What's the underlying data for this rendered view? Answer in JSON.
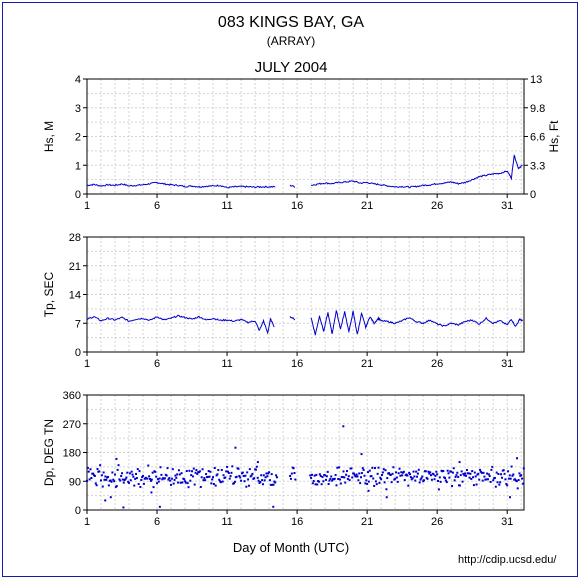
{
  "title": "083 KINGS BAY, GA",
  "subtitle": "(ARRAY)",
  "month": "JULY 2004",
  "xlabel": "Day of Month (UTC)",
  "url": "http://cdip.ucsd.edu/",
  "colors": {
    "series": "#0000cc",
    "frame": "#1a1aa8",
    "grid": "#c8c8c8"
  },
  "chart_data": [
    {
      "type": "line",
      "ylabel": "Hs, M",
      "ylabel_right": "Hs, Ft",
      "ylim": [
        0,
        4
      ],
      "yticks": [
        "0",
        "1",
        "2",
        "3",
        "4"
      ],
      "yticks_right": [
        "0",
        "3.3",
        "6.6",
        "9.8",
        "13"
      ],
      "xlim": [
        1,
        32.2
      ],
      "xticks": [
        "1",
        "6",
        "11",
        "16",
        "21",
        "26",
        "31"
      ],
      "grid": true,
      "gaps": [
        [
          14.6,
          15.5
        ],
        [
          15.9,
          16.9
        ]
      ],
      "x": [
        1,
        1.5,
        2,
        2.5,
        3,
        3.5,
        4,
        4.5,
        5,
        5.5,
        6,
        6.5,
        7,
        7.5,
        8,
        8.5,
        9,
        9.5,
        10,
        10.5,
        11,
        11.5,
        12,
        12.5,
        13,
        13.5,
        14,
        14.5,
        15.5,
        15.9,
        17,
        17.5,
        18,
        18.5,
        19,
        19.5,
        20,
        20.5,
        21,
        21.5,
        22,
        22.5,
        23,
        23.5,
        24,
        24.5,
        25,
        25.5,
        26,
        26.5,
        27,
        27.5,
        28,
        28.5,
        29,
        29.5,
        30,
        30.5,
        31,
        31.3,
        31.5,
        31.8,
        32.1
      ],
      "y": [
        0.3,
        0.33,
        0.28,
        0.32,
        0.3,
        0.35,
        0.28,
        0.3,
        0.32,
        0.36,
        0.4,
        0.35,
        0.32,
        0.3,
        0.26,
        0.28,
        0.25,
        0.27,
        0.28,
        0.3,
        0.22,
        0.25,
        0.26,
        0.25,
        0.24,
        0.25,
        0.25,
        0.25,
        0.3,
        0.25,
        0.3,
        0.35,
        0.38,
        0.36,
        0.4,
        0.42,
        0.45,
        0.38,
        0.4,
        0.35,
        0.32,
        0.28,
        0.25,
        0.26,
        0.24,
        0.26,
        0.3,
        0.32,
        0.36,
        0.38,
        0.42,
        0.36,
        0.4,
        0.5,
        0.6,
        0.65,
        0.7,
        0.72,
        0.8,
        0.55,
        1.35,
        0.9,
        1.0
      ]
    },
    {
      "type": "line",
      "ylabel": "Tp, SEC",
      "ylim": [
        0,
        28
      ],
      "yticks": [
        "0",
        "7",
        "14",
        "21",
        "28"
      ],
      "xlim": [
        1,
        32.2
      ],
      "xticks": [
        "1",
        "6",
        "11",
        "16",
        "21",
        "26",
        "31"
      ],
      "grid": true,
      "gaps": [
        [
          14.6,
          15.5
        ],
        [
          15.9,
          16.9
        ]
      ],
      "x": [
        1,
        1.5,
        2,
        2.5,
        3,
        3.5,
        4,
        4.5,
        5,
        5.5,
        6,
        6.5,
        7,
        7.5,
        8,
        8.5,
        9,
        9.5,
        10,
        10.5,
        11,
        11.5,
        12,
        12.5,
        13,
        13.3,
        13.6,
        13.9,
        14.1,
        14.4,
        15.5,
        15.9,
        17,
        17.3,
        17.6,
        17.9,
        18.2,
        18.5,
        18.8,
        19.1,
        19.4,
        19.7,
        20,
        20.3,
        20.6,
        20.9,
        21.2,
        21.5,
        21.8,
        22,
        22.5,
        23,
        23.5,
        24,
        24.5,
        25,
        25.5,
        26,
        26.5,
        27,
        27.5,
        28,
        28.5,
        29,
        29.5,
        30,
        30.5,
        31,
        31.3,
        31.6,
        31.9,
        32.1
      ],
      "y": [
        8,
        8.6,
        7.6,
        8.2,
        7.8,
        8.4,
        7.5,
        8,
        8.2,
        7.7,
        8.6,
        7.8,
        8.2,
        8.8,
        8.4,
        8,
        8.6,
        7.8,
        8.2,
        7.7,
        7.8,
        7.5,
        7.9,
        7.2,
        7.6,
        5.2,
        7.6,
        4.6,
        8.0,
        6.0,
        8.6,
        7.8,
        8.4,
        4.2,
        8.8,
        5.0,
        9.6,
        4.4,
        10.1,
        5.6,
        9.8,
        4.9,
        9.9,
        4.2,
        9.4,
        6.0,
        8.6,
        7.0,
        8.2,
        7.6,
        7.4,
        7.0,
        7.6,
        8.4,
        7.4,
        7.0,
        7.8,
        6.8,
        6.3,
        7.0,
        6.6,
        7.4,
        7.8,
        6.8,
        8.2,
        7.0,
        7.6,
        6.6,
        8.0,
        6.2,
        8.0,
        7.6
      ]
    },
    {
      "type": "scatter",
      "ylabel": "Dp, DEG TN",
      "ylim": [
        0,
        360
      ],
      "yticks": [
        "0",
        "90",
        "180",
        "270",
        "360"
      ],
      "xlim": [
        1,
        32.2
      ],
      "xticks": [
        "1",
        "6",
        "11",
        "16",
        "21",
        "26",
        "31"
      ],
      "grid": true,
      "gaps": [
        [
          14.6,
          15.5
        ],
        [
          15.9,
          16.9
        ]
      ],
      "center": 105,
      "spread": 22,
      "step": 0.0625,
      "outliers": [
        [
          2.3,
          30
        ],
        [
          2.7,
          40
        ],
        [
          3.1,
          160
        ],
        [
          3.6,
          8
        ],
        [
          5.6,
          55
        ],
        [
          6.2,
          10
        ],
        [
          11.6,
          195
        ],
        [
          13.2,
          150
        ],
        [
          14.3,
          10
        ],
        [
          19.3,
          262
        ],
        [
          20.6,
          175
        ],
        [
          21.1,
          60
        ],
        [
          22.4,
          40
        ],
        [
          27.6,
          150
        ],
        [
          31.7,
          162
        ],
        [
          31.2,
          40
        ]
      ]
    }
  ]
}
